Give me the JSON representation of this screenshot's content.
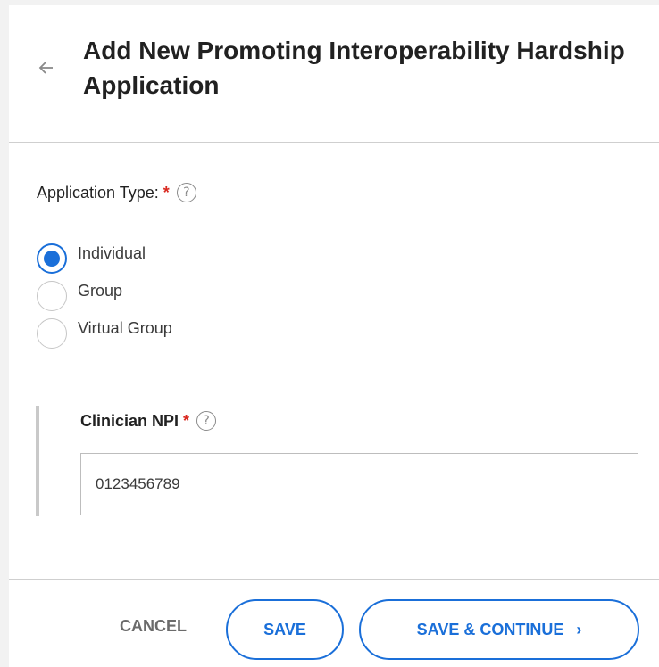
{
  "header": {
    "title": "Add New Promoting Interoperability Hardship Application"
  },
  "application_type": {
    "label": "Application Type:",
    "required_mark": "*",
    "help_glyph": "?",
    "options": [
      {
        "label": "Individual",
        "selected": true
      },
      {
        "label": "Group",
        "selected": false
      },
      {
        "label": "Virtual Group",
        "selected": false
      }
    ]
  },
  "clinician_npi": {
    "label": "Clinician NPI",
    "required_mark": "*",
    "help_glyph": "?",
    "value": "0123456789"
  },
  "footer": {
    "cancel_label": "CANCEL",
    "save_label": "SAVE",
    "save_continue_label": "SAVE & CONTINUE",
    "chevron_glyph": "›"
  },
  "colors": {
    "accent": "#1a6fd9",
    "required": "#d9281f"
  }
}
